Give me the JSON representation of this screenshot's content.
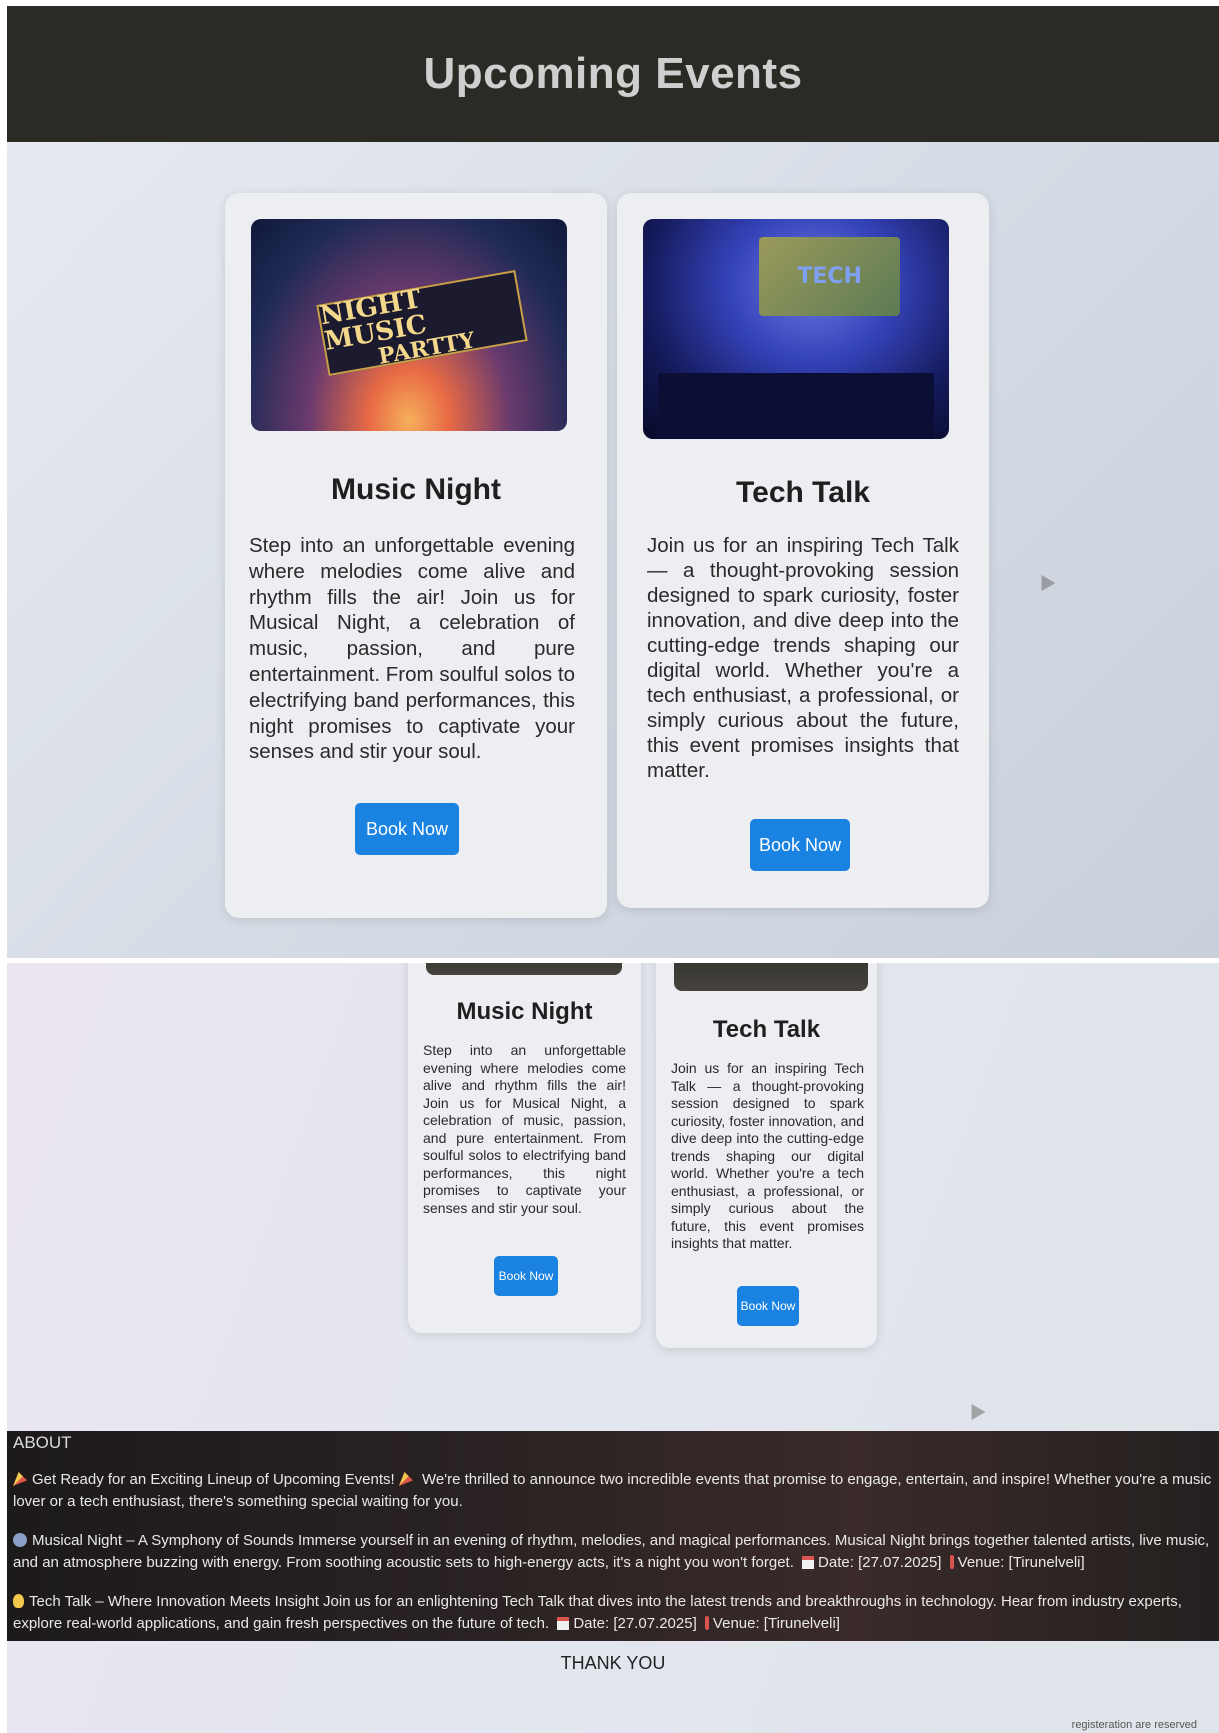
{
  "header": {
    "title": "Upcoming Events"
  },
  "events": [
    {
      "title": "Music Night",
      "image_alt": "NIGHT MUSIC PARTTY",
      "banner_line1": "NIGHT MUSIC",
      "banner_line2": "PARTTY",
      "description": "Step into an unforgettable evening where melodies come alive and rhythm fills the air! Join us for Musical Night, a celebration of music, passion, and pure entertainment. From soulful solos to electrifying band performances, this night promises to captivate your senses and stir your soul.",
      "button": "Book Now"
    },
    {
      "title": "Tech Talk",
      "screen_text": "TECH",
      "description": "Join us for an inspiring Tech Talk — a thought-provoking session designed to spark curiosity, foster innovation, and dive deep into the cutting-edge trends shaping our digital world. Whether you're a tech enthusiast, a professional, or simply curious about the future, this event promises insights that matter.",
      "button": "Book Now"
    }
  ],
  "about": {
    "heading": "ABOUT",
    "intro_title": "Get Ready for an Exciting Lineup of Upcoming Events!",
    "intro_body": "We're thrilled to announce two incredible events that promise to engage, entertain, and inspire! Whether you're a music lover or a tech enthusiast, there's something special waiting for you.",
    "music_text": "Musical Night – A Symphony of Sounds Immerse yourself in an evening of rhythm, melodies, and magical performances. Musical Night brings together talented artists, live music, and an atmosphere buzzing with energy. From soothing acoustic sets to high-energy acts, it's a night you won't forget.",
    "music_date": "Date: [27.07.2025]",
    "music_venue": "Venue: [Tirunelveli]",
    "tech_text": "Tech Talk – Where Innovation Meets Insight Join us for an enlightening Tech Talk that dives into the latest trends and breakthroughs in technology. Hear from industry experts, explore real-world applications, and gain fresh perspectives on the future of tech.",
    "tech_date": "Date: [27.07.2025]",
    "tech_venue": "Venue: [Tirunelveli]"
  },
  "footer": {
    "thanks": "THANK YOU",
    "copyright": "registeration are reserved"
  },
  "colors": {
    "header_bg": "#2b2a25",
    "button": "#1a82e0",
    "about_bg": "#1d1a1b"
  }
}
